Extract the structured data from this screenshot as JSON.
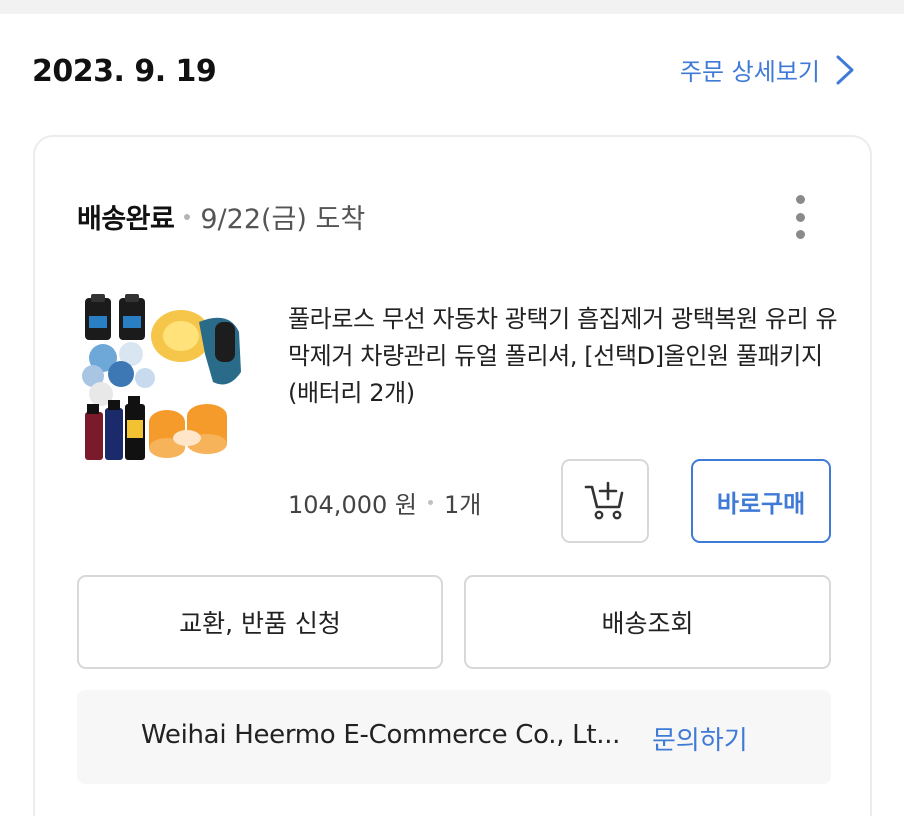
{
  "order": {
    "date": "2023. 9. 19",
    "detail_link": "주문 상세보기"
  },
  "shipment": {
    "status": "배송완료",
    "arrival": "9/22(금) 도착"
  },
  "product": {
    "name": "풀라로스 무선 자동차 광택기 흠집제거 광택복원 유리 유막제거 차량관리 듀얼 폴리셔, [선택D]올인원 풀패키지(배터리 2개)",
    "price": "104,000 원",
    "quantity": "1개",
    "buy_now_label": "바로구매",
    "cart_icon": "add-to-cart-icon"
  },
  "actions": {
    "exchange_label": "교환, 반품 신청",
    "tracking_label": "배송조회"
  },
  "seller": {
    "name": "Weihai Heermo E-Commerce Co., Lt...",
    "inquiry_label": "문의하기"
  },
  "colors": {
    "accent": "#3f7ad7",
    "border": "#d8d8d8",
    "seller_bg": "#f7f7f7"
  }
}
